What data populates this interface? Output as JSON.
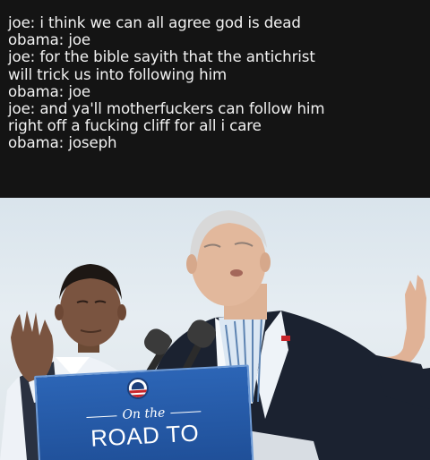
{
  "caption": {
    "lines": [
      "joe: i think we can all agree god is dead",
      "obama: joe",
      "joe: for the bible sayith that the antichrist",
      "will trick us into following him",
      "obama: joe",
      "joe: and ya'll motherfuckers can follow him",
      "right off a fucking cliff for all i care",
      "obama: joseph"
    ]
  },
  "photo": {
    "sign": {
      "small_text": "On the",
      "large_text": "ROAD TO"
    }
  }
}
